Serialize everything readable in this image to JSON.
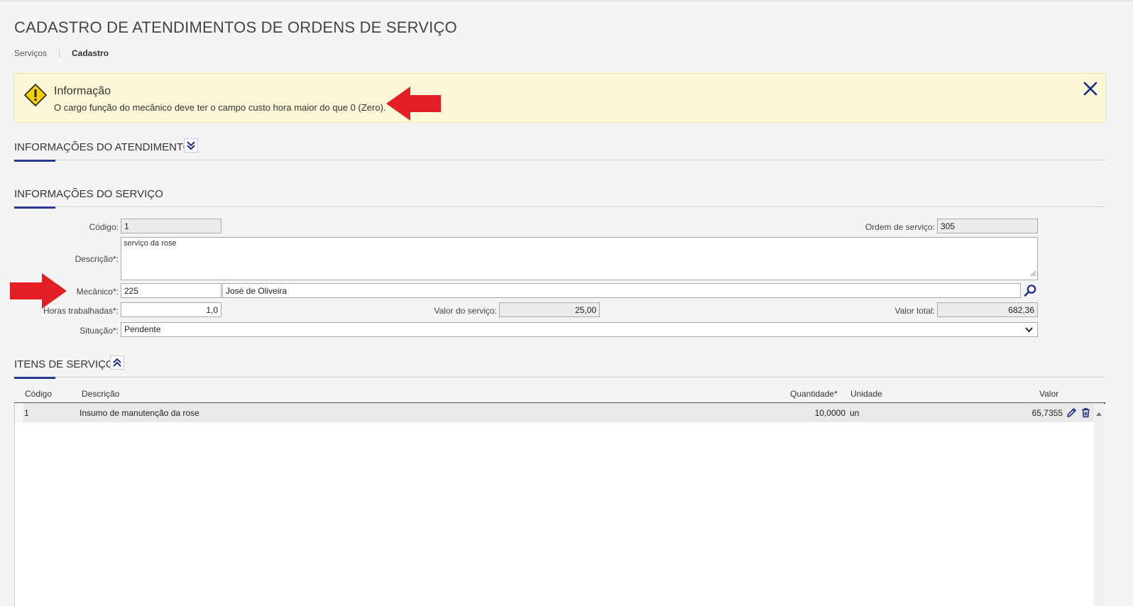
{
  "page": {
    "title": "CADASTRO DE ATENDIMENTOS DE ORDENS DE SERVIÇO"
  },
  "breadcrumb": {
    "items": [
      "Serviços",
      "Cadastro"
    ]
  },
  "alert": {
    "title": "Informação",
    "message": "O cargo função do mecânico deve ter o campo custo hora maior do que 0 (Zero).",
    "icon": "warning-icon",
    "close_icon": "close-icon"
  },
  "sections": {
    "atendimento": "INFORMAÇÕES DO ATENDIMENTO",
    "servico": "INFORMAÇÕES DO SERVIÇO",
    "itens": "ITENS DE SERVIÇO"
  },
  "form": {
    "codigo": {
      "label": "Código:",
      "value": "1"
    },
    "ordem": {
      "label": "Ordem de serviço:",
      "value": "305"
    },
    "descricao": {
      "label": "Descrição*:",
      "value": "serviço da rose"
    },
    "mecanico": {
      "label": "Mecânico*:",
      "code": "225",
      "name": "José de Oliveira"
    },
    "horas": {
      "label": "Horas trabalhadas*:",
      "value": "1,0"
    },
    "valor_servico": {
      "label": "Valor do serviço:",
      "value": "25,00"
    },
    "valor_total": {
      "label": "Valor total:",
      "value": "682,36"
    },
    "situacao": {
      "label": "Situação*:",
      "value": "Pendente"
    }
  },
  "table": {
    "headers": {
      "codigo": "Código",
      "descricao": "Descrição",
      "quantidade": "Quantidade*",
      "unidade": "Unidade",
      "valor": "Valor"
    },
    "rows": [
      {
        "codigo": "1",
        "descricao": "Insumo de manutenção da rose",
        "quantidade": "10,0000",
        "unidade": "un",
        "valor": "65,7355"
      }
    ]
  },
  "colors": {
    "accent": "#2a3890",
    "alert_bg": "#fcf7d6",
    "arrow": "#e31e24",
    "warning": "#f5d000"
  }
}
